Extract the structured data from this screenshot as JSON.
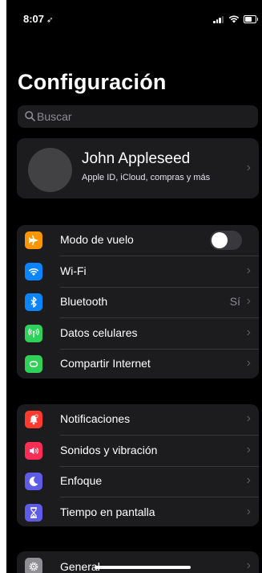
{
  "status": {
    "time": "8:07",
    "location_icon": "location-arrow-icon"
  },
  "page": {
    "title": "Configuración"
  },
  "search": {
    "placeholder": "Buscar"
  },
  "profile": {
    "name": "John Appleseed",
    "subtitle": "Apple ID, iCloud, compras y más"
  },
  "group1": [
    {
      "label": "Modo de vuelo",
      "icon": "airplane-icon",
      "color": "#ff9500",
      "toggle": false
    },
    {
      "label": "Wi-Fi",
      "icon": "wifi-icon",
      "color": "#0a84ff"
    },
    {
      "label": "Bluetooth",
      "icon": "bluetooth-icon",
      "color": "#0a84ff",
      "value": "Sí"
    },
    {
      "label": "Datos celulares",
      "icon": "antenna-icon",
      "color": "#30d158"
    },
    {
      "label": "Compartir Internet",
      "icon": "link-icon",
      "color": "#30d158"
    }
  ],
  "group2": [
    {
      "label": "Notificaciones",
      "icon": "bell-icon",
      "color": "#ff3b30"
    },
    {
      "label": "Sonidos y vibración",
      "icon": "speaker-icon",
      "color": "#ff2d55"
    },
    {
      "label": "Enfoque",
      "icon": "moon-icon",
      "color": "#5e5ce6"
    },
    {
      "label": "Tiempo en pantalla",
      "icon": "hourglass-icon",
      "color": "#5e5ce6"
    }
  ],
  "group3": [
    {
      "label": "General",
      "icon": "gear-icon",
      "color": "#8e8e93"
    }
  ],
  "colors": {
    "background": "#000000",
    "cell": "#1c1c1e",
    "separator": "#38383a",
    "secondary_text": "#8e8e93"
  }
}
